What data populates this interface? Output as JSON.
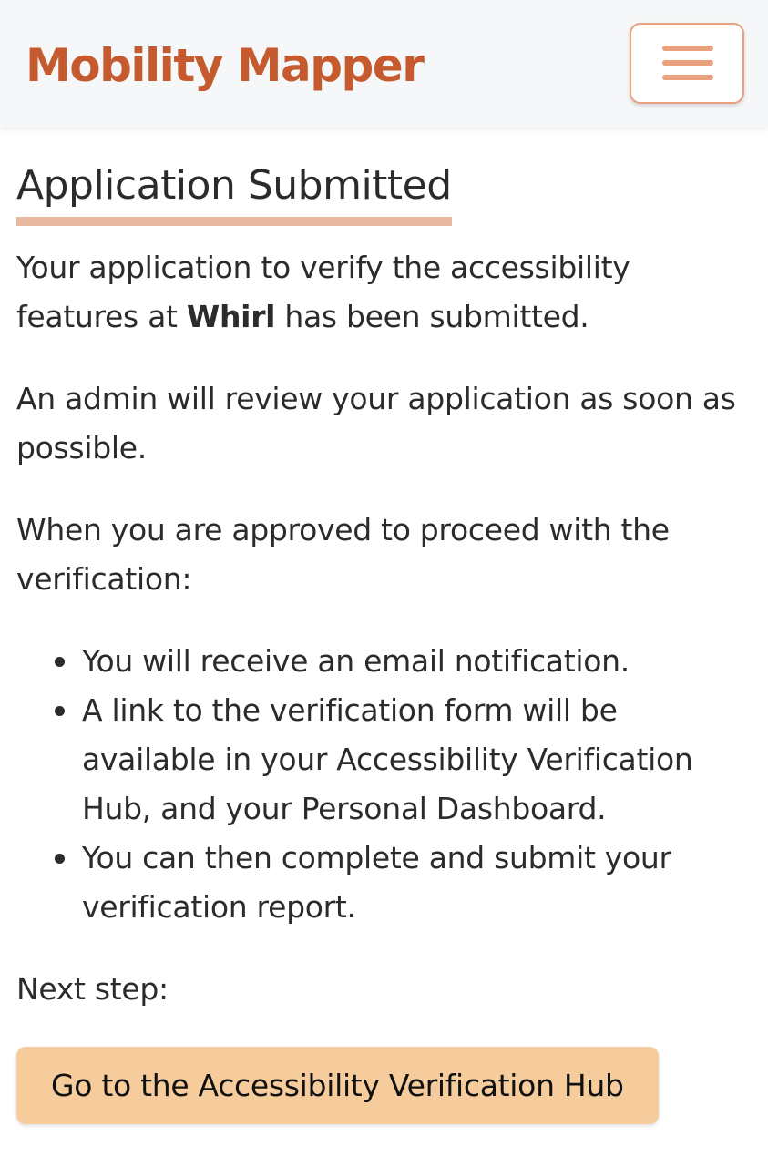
{
  "navbar": {
    "brand": "Mobility Mapper",
    "menu_icon": "hamburger-menu-icon",
    "accent_color": "#c45a2e",
    "menu_border_color": "#e8a07f"
  },
  "main": {
    "heading": "Application Submitted",
    "intro_before": "Your application to verify the accessibility features at ",
    "venue_name": "Whirl",
    "intro_after": " has been submitted.",
    "review_text": "An admin will review your application as soon as possible.",
    "approved_text": "When you are approved to proceed with the verification:",
    "steps": [
      "You will receive an email notification.",
      "A link to the verification form will be available in your Accessibility Verification Hub, and your Personal Dashboard.",
      "You can then complete and submit your verification report."
    ],
    "next_label": "Next step:",
    "cta_label": "Go to the Accessibility Verification Hub",
    "cta_color": "#f6cc9c"
  }
}
